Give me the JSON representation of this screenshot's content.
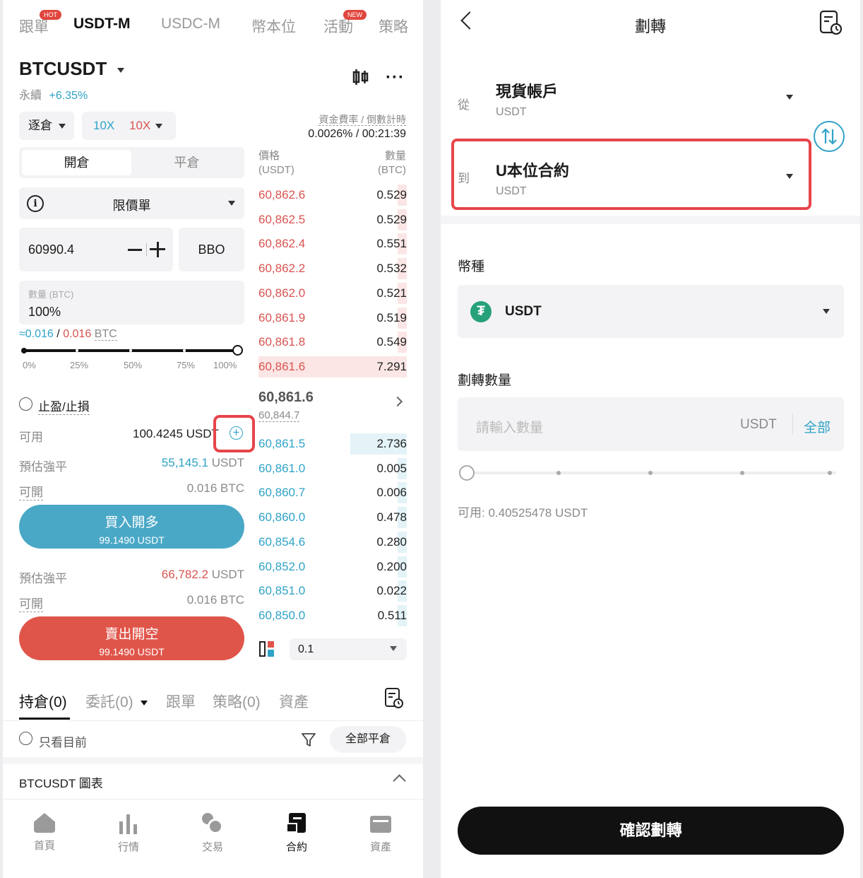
{
  "left": {
    "top_tabs": [
      {
        "label": "跟單",
        "badge": "HOT"
      },
      {
        "label": "USDT-M"
      },
      {
        "label": "USDC-M"
      },
      {
        "label": "幣本位"
      },
      {
        "label": "活動",
        "badge": "NEW"
      },
      {
        "label": "策略"
      }
    ],
    "pair": "BTCUSDT",
    "pair_type": "永續",
    "change": "+6.35%",
    "margin_mode": "逐倉",
    "lev_long": "10X",
    "lev_short": "10X",
    "funding_label": "資金費率 / 倒數計時",
    "funding_value": "0.0026% / 00:21:39",
    "open_tab": "開倉",
    "close_tab": "平倉",
    "order_type": "限價單",
    "price": "60990.4",
    "bbo": "BBO",
    "qty_label": "數量 (BTC)",
    "qty_value": "100%",
    "approx_long": "≈0.016",
    "approx_short": "0.016",
    "approx_unit": "BTC",
    "approx_sep": "/",
    "slider_marks": [
      "0%",
      "25%",
      "50%",
      "75%",
      "100%"
    ],
    "tpsl": "止盈/止損",
    "available_label": "可用",
    "available_value": "100.4245 USDT",
    "liq_label": "預估強平",
    "liq_long_value": "55,145.1",
    "liq_unit": "USDT",
    "open_label": "可開",
    "open_long_value": "0.016 BTC",
    "buy_label": "買入開多",
    "buy_amount": "99.1490 USDT",
    "liq_short_value": "66,782.2",
    "open_short_value": "0.016 BTC",
    "sell_label": "賣出開空",
    "sell_amount": "99.1490 USDT",
    "ob_price_header": "價格",
    "ob_price_unit": "(USDT)",
    "ob_qty_header": "數量",
    "ob_qty_unit": "(BTC)",
    "asks": [
      [
        "60,862.6",
        "0.529"
      ],
      [
        "60,862.5",
        "0.529"
      ],
      [
        "60,862.4",
        "0.551"
      ],
      [
        "60,862.2",
        "0.532"
      ],
      [
        "60,862.0",
        "0.521"
      ],
      [
        "60,861.9",
        "0.519"
      ],
      [
        "60,861.8",
        "0.549"
      ],
      [
        "60,861.6",
        "7.291"
      ]
    ],
    "last_price": "60,861.6",
    "mark_price": "60,844.7",
    "bids": [
      [
        "60,861.5",
        "2.736"
      ],
      [
        "60,861.0",
        "0.005"
      ],
      [
        "60,860.7",
        "0.006"
      ],
      [
        "60,860.0",
        "0.478"
      ],
      [
        "60,854.6",
        "0.280"
      ],
      [
        "60,852.0",
        "0.200"
      ],
      [
        "60,851.0",
        "0.022"
      ],
      [
        "60,850.0",
        "0.511"
      ]
    ],
    "depth_step": "0.1",
    "bottom_tabs": [
      {
        "label": "持倉(0)"
      },
      {
        "label": "委託(0)"
      },
      {
        "label": "跟單"
      },
      {
        "label": "策略(0)"
      },
      {
        "label": "資產"
      }
    ],
    "only_current": "只看目前",
    "close_all": "全部平倉",
    "chart_section": "BTCUSDT 圖表",
    "nav": [
      {
        "label": "首頁"
      },
      {
        "label": "行情"
      },
      {
        "label": "交易"
      },
      {
        "label": "合約"
      },
      {
        "label": "資產"
      }
    ],
    "accent": "#2fa3c7",
    "sell_color": "#e0554a",
    "buy_color": "#4aa8c7"
  },
  "right": {
    "title": "劃轉",
    "from_label": "從",
    "from_account": "現貨帳戶",
    "from_coin": "USDT",
    "to_label": "到",
    "to_account": "U本位合約",
    "to_coin": "USDT",
    "currency_label": "幣種",
    "currency_value": "USDT",
    "amount_label": "劃轉數量",
    "amount_placeholder": "請輸入數量",
    "amount_unit": "USDT",
    "amount_all": "全部",
    "available": "可用: 0.40525478 USDT",
    "confirm": "確認劃轉",
    "highlight_color": "#e6454a"
  }
}
